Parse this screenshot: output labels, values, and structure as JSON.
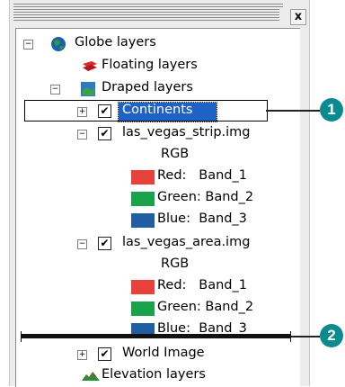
{
  "panel": {
    "close_label": "x",
    "tree": {
      "globe_layers": "Globe layers",
      "floating_layers": "Floating layers",
      "draped_layers": "Draped layers",
      "continents": "Continents",
      "las_vegas_strip": "las_vegas_strip.img",
      "strip_rgb": "RGB",
      "strip_red": "Red:   Band_1",
      "strip_green": "Green: Band_2",
      "strip_blue": "Blue:  Band_3",
      "las_vegas_area": "las_vegas_area.img",
      "area_rgb": "RGB",
      "area_red": "Red:   Band_1",
      "area_green": "Green: Band_2",
      "area_blue": "Blue:  Band_3",
      "world_image": "World Image",
      "elevation_layers": "Elevation layers"
    },
    "expander_collapsed": "+",
    "expander_expanded": "−",
    "check_mark": "✔",
    "colors": {
      "red": "#e8413c",
      "green": "#1aa24a",
      "blue": "#1f5ea0",
      "selection": "#1d62c4",
      "callout": "#0b8a8f"
    }
  },
  "callouts": {
    "one": "1",
    "two": "2"
  }
}
